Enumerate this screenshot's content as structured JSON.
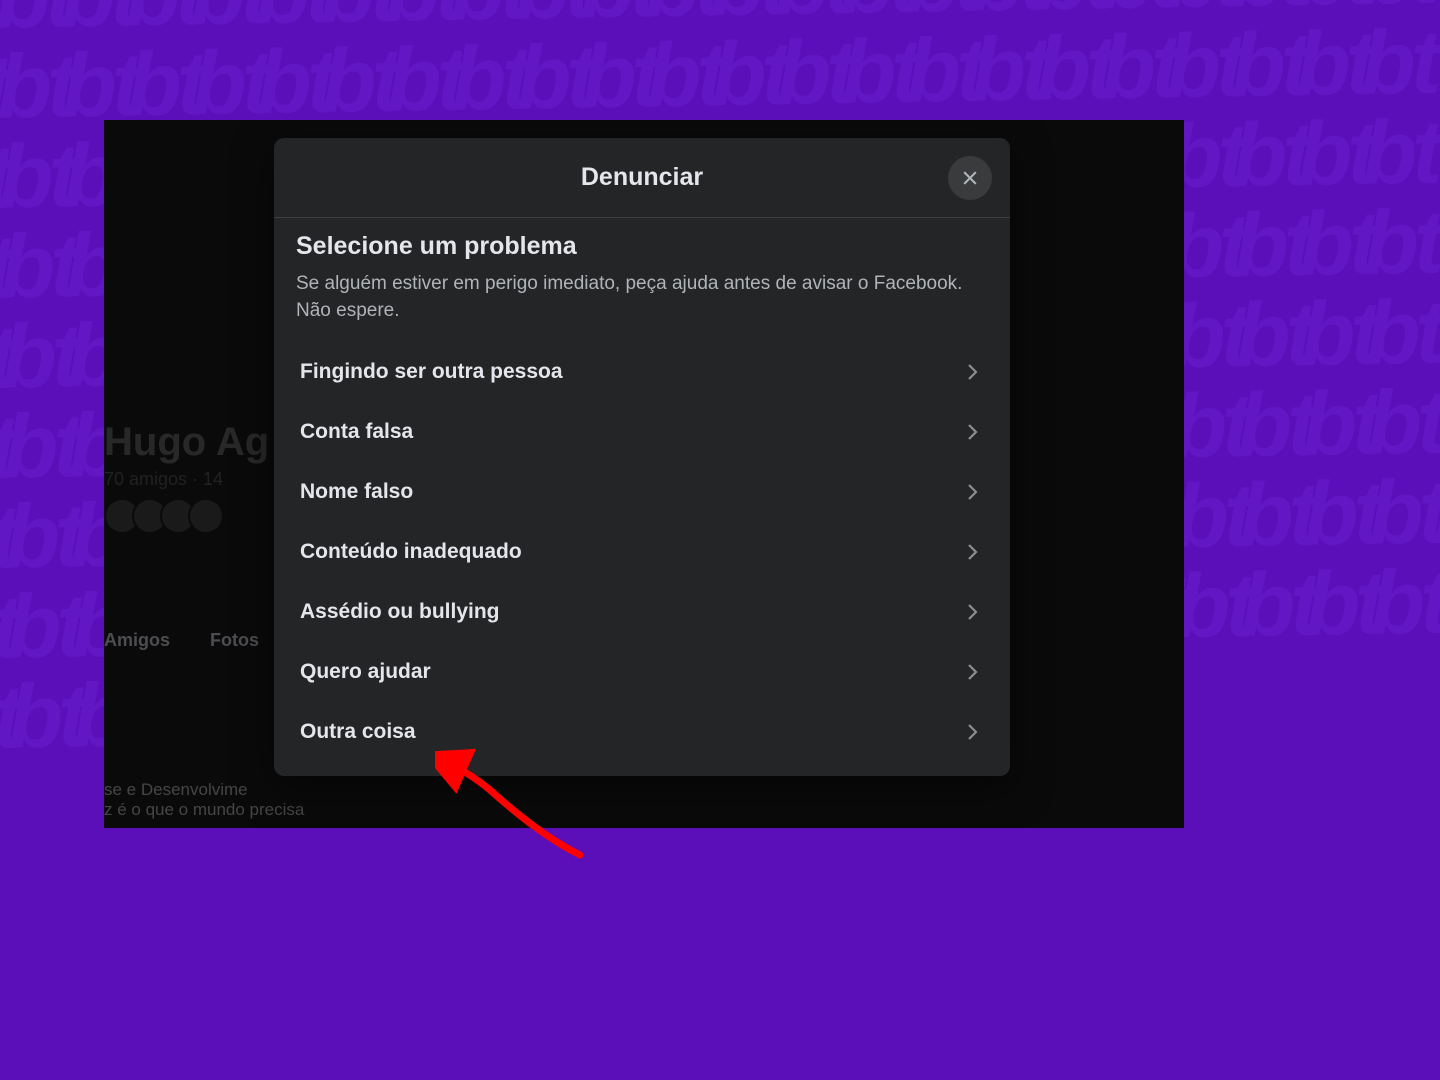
{
  "modal": {
    "title": "Denunciar",
    "section_title": "Selecione um problema",
    "section_desc": "Se alguém estiver em perigo imediato, peça ajuda antes de avisar o Facebook. Não espere.",
    "options": [
      "Fingindo ser outra pessoa",
      "Conta falsa",
      "Nome falso",
      "Conteúdo inadequado",
      "Assédio ou bullying",
      "Quero ajudar",
      "Outra coisa"
    ]
  },
  "background": {
    "profile_name": "Hugo Ag",
    "profile_sub": "70 amigos · 14",
    "tabs": [
      "Amigos",
      "Fotos"
    ],
    "bottom_line1": "se e Desenvolvime",
    "bottom_line2": "z é o que o mundo precisa"
  },
  "annotation": {
    "arrow_color": "#ff0000"
  }
}
